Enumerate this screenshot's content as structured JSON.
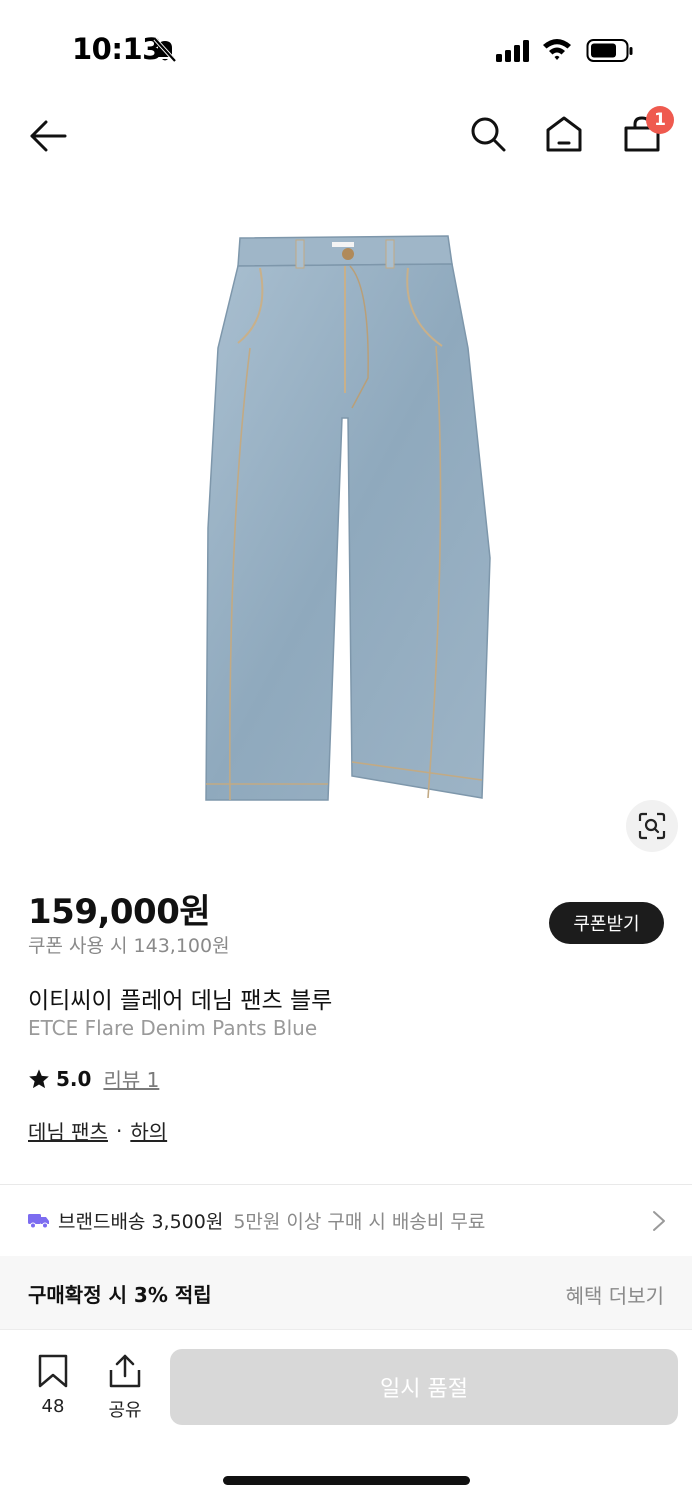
{
  "status_bar": {
    "time": "10:13"
  },
  "nav": {
    "cart_count": "1"
  },
  "product": {
    "price": "159,000원",
    "coupon_price": "쿠폰 사용 시 143,100원",
    "coupon_button": "쿠폰받기",
    "title_ko": "이티씨이 플레어 데님 팬츠 블루",
    "title_en": "ETCE Flare Denim Pants Blue",
    "rating": "5.0",
    "review_link": "리뷰 1",
    "category_1": "데님 팬츠",
    "category_separator": "·",
    "category_2": "하의"
  },
  "shipping": {
    "main": "브랜드배송 3,500원",
    "sub": "5만원 이상 구매 시 배송비 무료"
  },
  "benefit": {
    "title": "구매확정 시 3% 적립",
    "more": "혜택 더보기"
  },
  "bottom_bar": {
    "wish_count": "48",
    "share_label": "공유",
    "soldout_label": "일시 품절"
  },
  "colors": {
    "badge": "#ef5a4f",
    "denim": "#93aec3",
    "truck": "#7c6cf0",
    "soldout": "#d8d8d8"
  },
  "icons": [
    "bell-off-icon",
    "signal-icon",
    "wifi-icon",
    "battery-icon",
    "back-arrow-icon",
    "search-icon",
    "home-icon",
    "cart-icon",
    "lens-search-icon",
    "star-icon",
    "truck-icon",
    "chevron-right-icon",
    "bookmark-icon",
    "share-icon"
  ]
}
